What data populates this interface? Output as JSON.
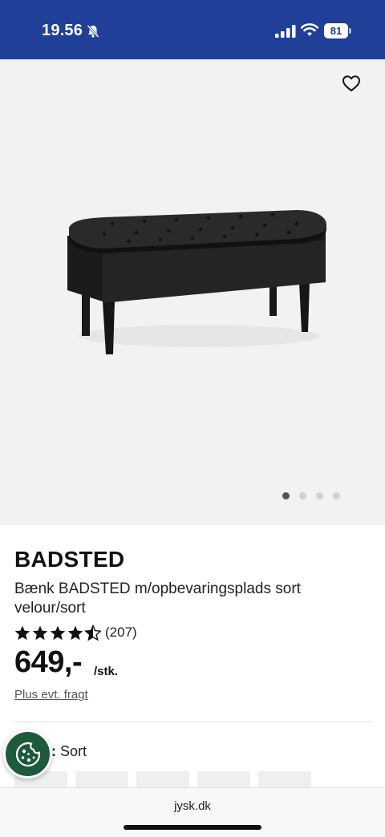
{
  "status_bar": {
    "time": "19.56",
    "battery_level": "81",
    "background_color": "#1f3f99",
    "icons": [
      "bell-off-icon",
      "signal-icon",
      "wifi-icon",
      "battery-icon"
    ]
  },
  "hero": {
    "favorite_icon": "heart-icon",
    "image_alt": "black upholstered storage bench",
    "carousel": {
      "total": 4,
      "active_index": 0
    }
  },
  "product": {
    "brand": "BADSTED",
    "description": "Bænk BADSTED m/opbevaringsplads sort velour/sort",
    "rating": {
      "stars": 4.5,
      "max": 5,
      "count_label": "(207)"
    },
    "price": "649,-",
    "price_unit": "/stk.",
    "shipping_note": "Plus evt. fragt"
  },
  "color_option": {
    "colon": ":",
    "value": "Sort",
    "swatch_count": 5
  },
  "cookie_button": {
    "icon": "cookie-icon",
    "color": "#1d5a3c"
  },
  "browser": {
    "url": "jysk.dk"
  }
}
